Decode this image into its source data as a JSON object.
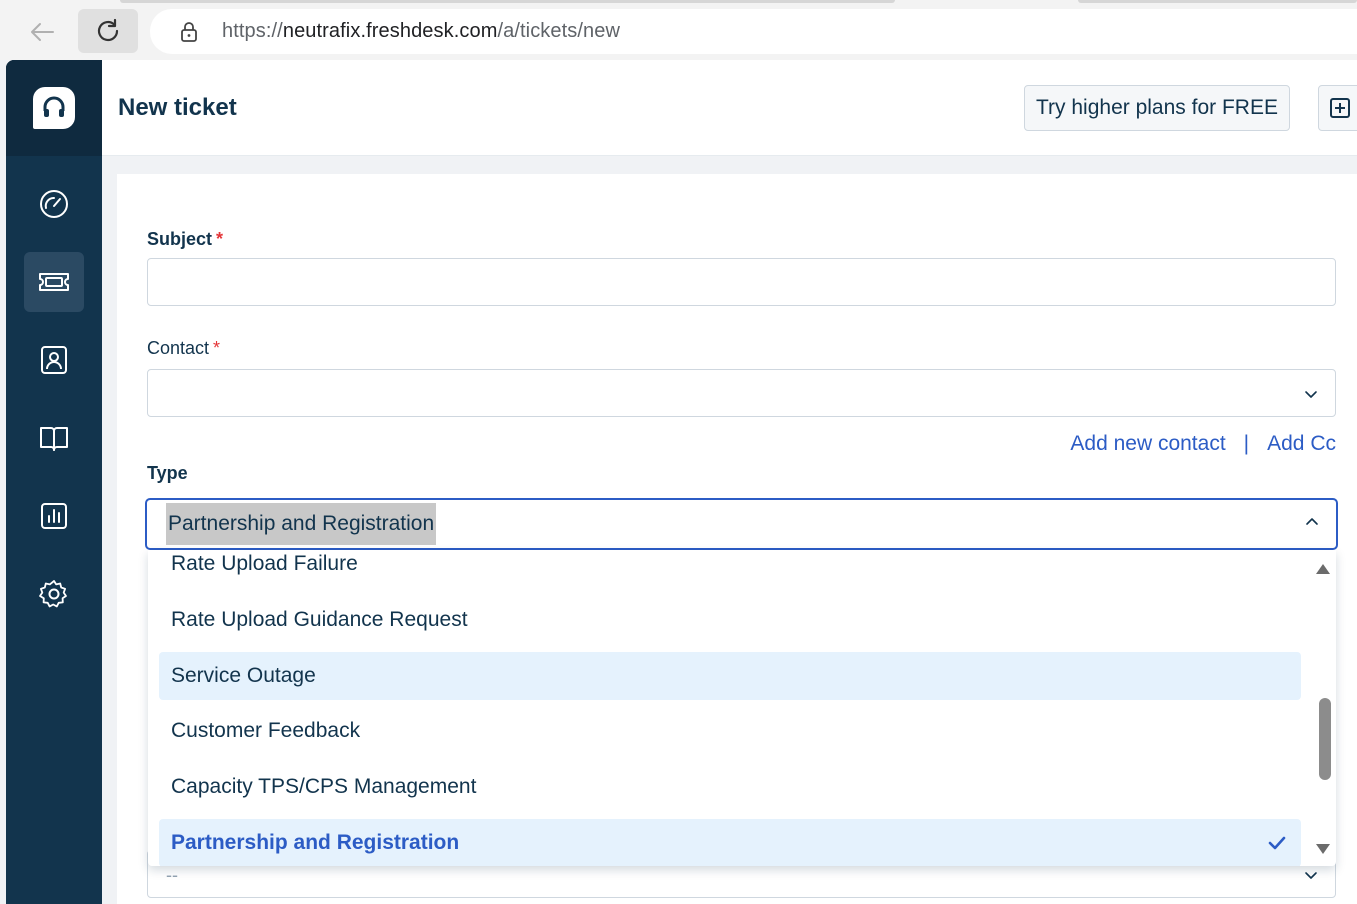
{
  "browser": {
    "url_prefix": "https://",
    "url_host": "neutrafix.freshdesk.com",
    "url_path": "/a/tickets/new"
  },
  "sidebar": {
    "items": [
      {
        "name": "dashboard",
        "icon": "speedometer-icon",
        "active": false
      },
      {
        "name": "tickets",
        "icon": "ticket-icon",
        "active": true
      },
      {
        "name": "contacts",
        "icon": "contact-card-icon",
        "active": false
      },
      {
        "name": "solutions",
        "icon": "book-icon",
        "active": false
      },
      {
        "name": "reports",
        "icon": "bar-chart-icon",
        "active": false
      },
      {
        "name": "admin",
        "icon": "gear-icon",
        "active": false
      }
    ]
  },
  "header": {
    "title": "New ticket",
    "trial_button": "Try higher plans for FREE"
  },
  "form": {
    "subject_label": "Subject",
    "contact_label": "Contact",
    "required_mark": "*",
    "add_new_contact": "Add new contact",
    "link_separator": "|",
    "add_cc": "Add Cc",
    "type_label": "Type",
    "type_value": "Partnership and Registration",
    "next_field_placeholder": "--"
  },
  "type_dropdown": {
    "options": [
      "Rate Upload Failure",
      "Rate Upload Guidance Request",
      "Service Outage",
      "Customer Feedback",
      "Capacity TPS/CPS Management",
      "Partnership and Registration"
    ],
    "hovered": "Service Outage",
    "selected": "Partnership and Registration"
  },
  "colors": {
    "sidebar": "#12344d",
    "accent": "#2c5cc5",
    "required": "#e43538",
    "highlight": "#e5f2fd"
  }
}
